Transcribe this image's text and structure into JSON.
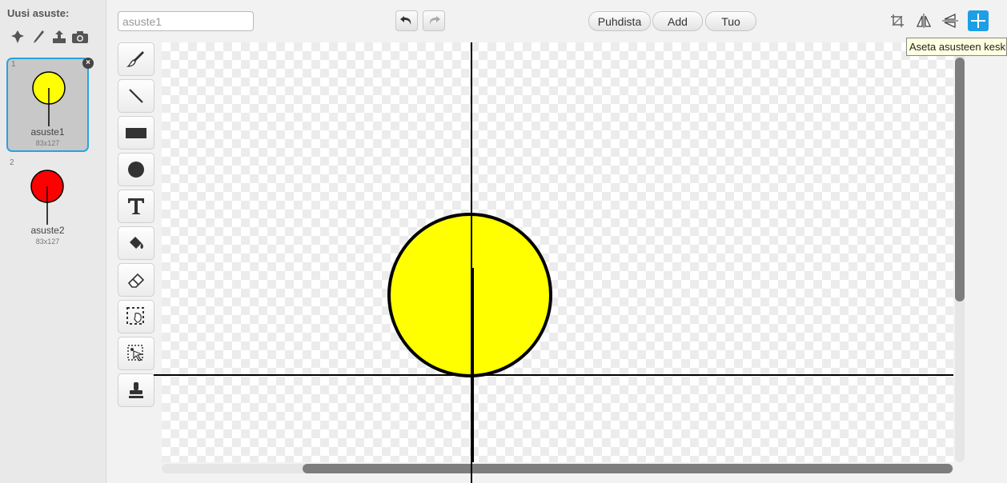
{
  "sidebar": {
    "new_costume_label": "Uusi asuste:",
    "new_icons": [
      "paint-sprite-icon",
      "paintbrush-icon",
      "upload-icon",
      "camera-icon"
    ],
    "costumes": [
      {
        "number": "1",
        "name": "asuste1",
        "size": "83x127",
        "color": "#ffff00",
        "selected": true
      },
      {
        "number": "2",
        "name": "asuste2",
        "size": "83x127",
        "color": "#ff0000",
        "selected": false
      }
    ]
  },
  "editor": {
    "costume_name_value": "",
    "costume_name_placeholder": "asuste1",
    "undo_icon": "undo-icon",
    "redo_icon": "redo-icon",
    "buttons": {
      "clear": "Puhdista",
      "add": "Add",
      "import": "Tuo"
    },
    "top_right_tools": [
      "crop-icon",
      "flip-horizontal-icon",
      "flip-vertical-icon",
      "set-costume-center-icon"
    ],
    "tooltip": "Aseta asusteen keskipiste",
    "tools": [
      "brush-icon",
      "line-icon",
      "rectangle-icon",
      "ellipse-icon",
      "text-icon",
      "fill-icon",
      "eraser-icon",
      "select-icon",
      "select-duplicate-icon",
      "stamp-icon"
    ]
  },
  "colors": {
    "accent": "#1d9fe6",
    "costume1_fill": "#ffff00",
    "costume2_fill": "#ff0000"
  }
}
